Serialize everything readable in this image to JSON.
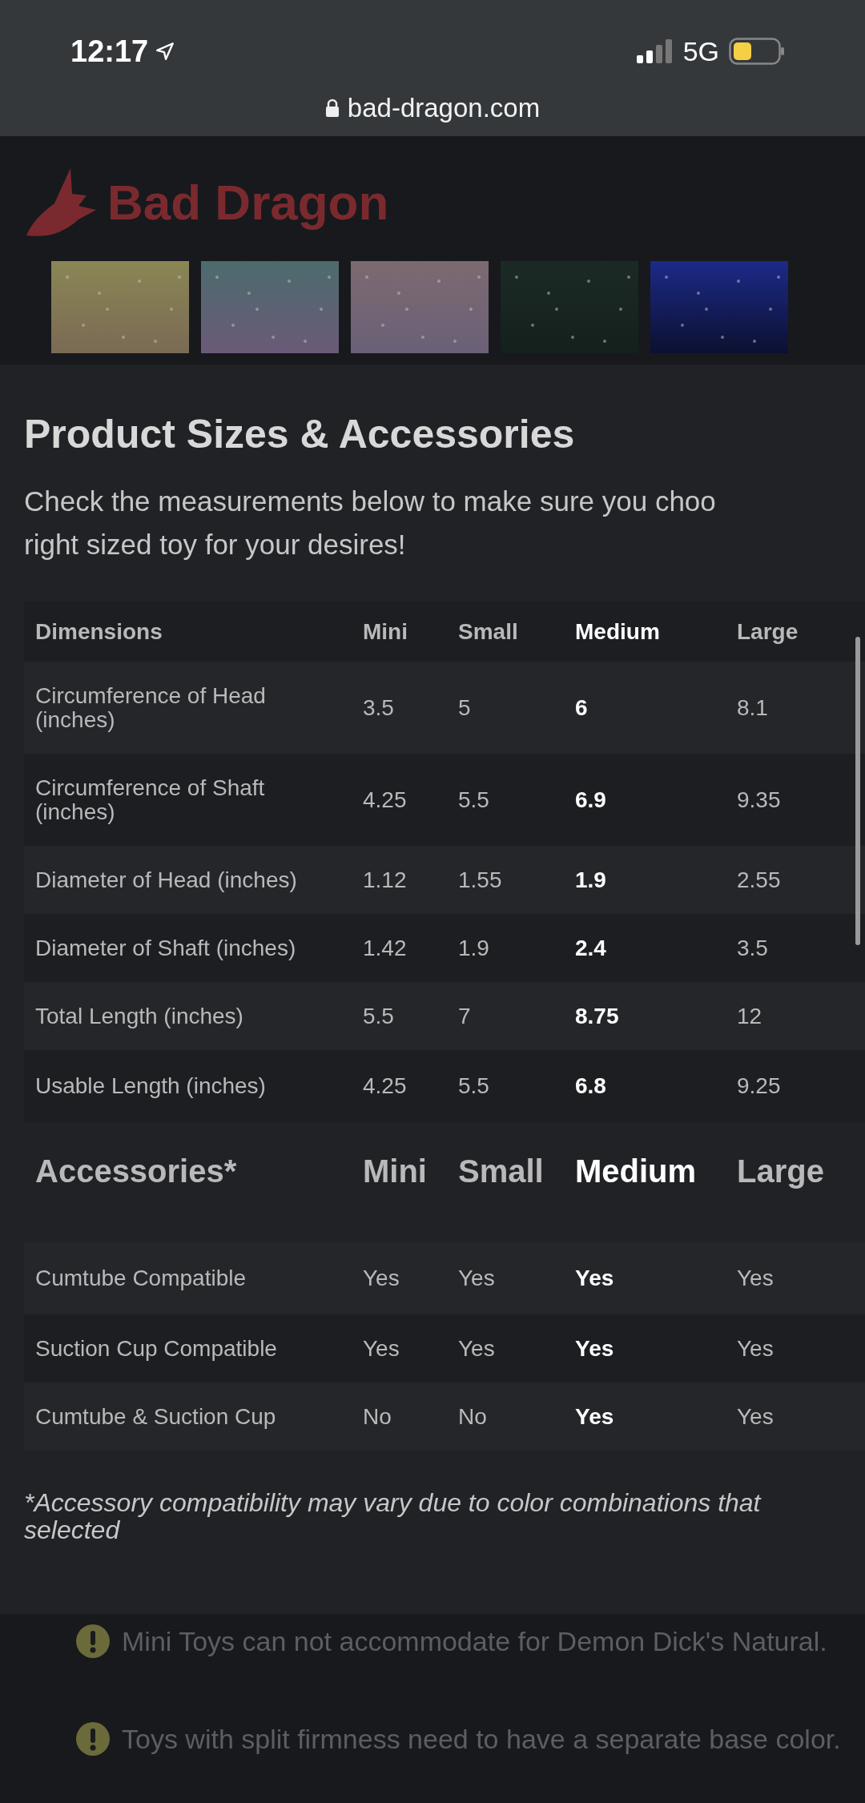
{
  "status_bar": {
    "time": "12:17",
    "network": "5G"
  },
  "browser": {
    "url": "bad-dragon.com"
  },
  "site_header": {
    "logo": "Bad Dragon"
  },
  "swatches": [
    {
      "kind": "picture"
    },
    {
      "kind": "picture"
    },
    {
      "kind": "picture"
    },
    {
      "kind": "picture"
    },
    {
      "kind": "picture"
    }
  ],
  "modal": {
    "title": "Product Sizes & Accessories",
    "intro_lines": [
      "Check the measurements below to make sure you choo",
      "right sized toy for your desires!"
    ],
    "dimensions_table": {
      "columns": [
        {
          "label": "Dimensions",
          "selected": false
        },
        {
          "label": "Mini",
          "selected": false
        },
        {
          "label": "Small",
          "selected": false
        },
        {
          "label": "Medium",
          "selected": true
        },
        {
          "label": "Large",
          "selected": false
        }
      ],
      "rows": [
        {
          "label": "Circumference of Head (inches)",
          "values": [
            "3.5",
            "5",
            "6",
            "8.1"
          ]
        },
        {
          "label": "Circumference of Shaft (inches)",
          "values": [
            "4.25",
            "5.5",
            "6.9",
            "9.35"
          ]
        },
        {
          "label": "Diameter of Head (inches)",
          "values": [
            "1.12",
            "1.55",
            "1.9",
            "2.55"
          ]
        },
        {
          "label": "Diameter of Shaft (inches)",
          "values": [
            "1.42",
            "1.9",
            "2.4",
            "3.5"
          ]
        },
        {
          "label": "Total Length (inches)",
          "values": [
            "5.5",
            "7",
            "8.75",
            "12"
          ]
        },
        {
          "label": "Usable Length (inches)",
          "values": [
            "4.25",
            "5.5",
            "6.8",
            "9.25"
          ]
        }
      ]
    },
    "accessories_table": {
      "columns": [
        {
          "label": "Accessories*",
          "selected": false
        },
        {
          "label": "Mini",
          "selected": false
        },
        {
          "label": "Small",
          "selected": false
        },
        {
          "label": "Medium",
          "selected": true
        },
        {
          "label": "Large",
          "selected": false
        }
      ],
      "rows": [
        {
          "label": "Cumtube Compatible",
          "values": [
            "Yes",
            "Yes",
            "Yes",
            "Yes"
          ]
        },
        {
          "label": "Suction Cup Compatible",
          "values": [
            "Yes",
            "Yes",
            "Yes",
            "Yes"
          ]
        },
        {
          "label": "Cumtube & Suction Cup",
          "values": [
            "No",
            "No",
            "Yes",
            "Yes"
          ]
        }
      ]
    },
    "footnote": "*Accessory compatibility may vary due to color combinations that selected"
  },
  "notices": [
    "Mini Toys can not accommodate for Demon Dick's Natural.",
    "Toys with split firmness need to have a separate base color."
  ]
}
